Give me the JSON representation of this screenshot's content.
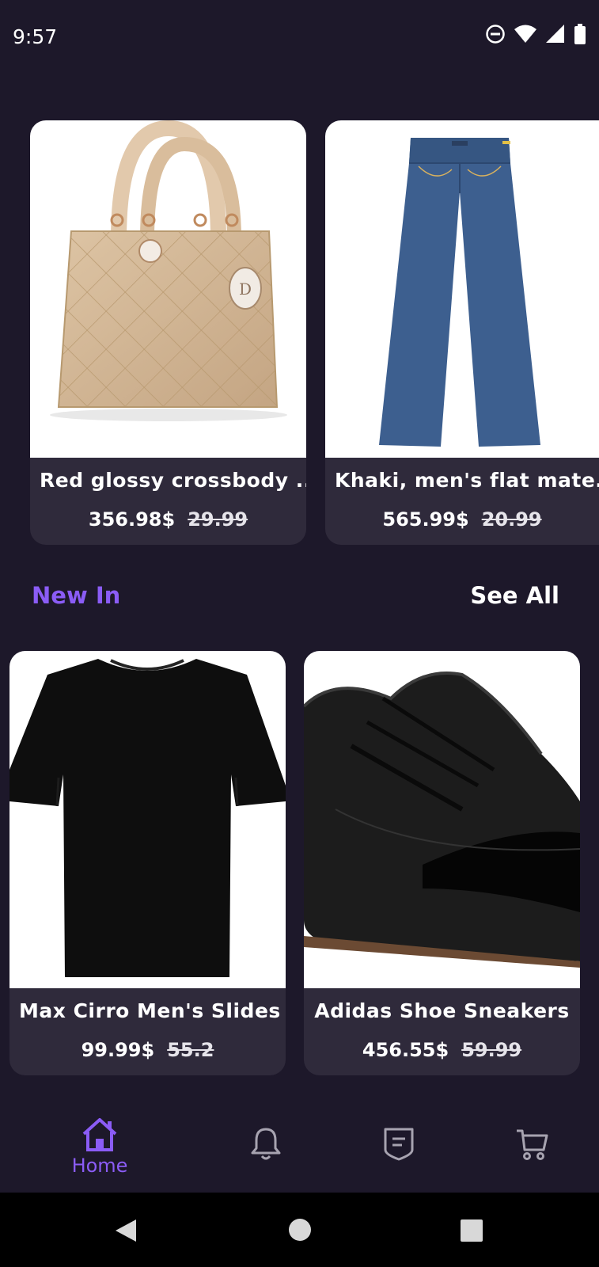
{
  "status_bar": {
    "time": "9:57",
    "icons": [
      "do-not-disturb-icon",
      "wifi-icon",
      "signal-icon",
      "battery-icon"
    ]
  },
  "featured": [
    {
      "name": "Red glossy crossbody ...",
      "price": "356.98$",
      "old_price": "29.99",
      "image": "beige-handbag"
    },
    {
      "name": "Khaki, men's flat mate...",
      "price": "565.99$",
      "old_price": "20.99",
      "image": "blue-jeans"
    }
  ],
  "new_in": {
    "title": "New In",
    "see_all": "See All",
    "items": [
      {
        "name": "Max Cirro Men's Slides",
        "price": "99.99$",
        "old_price": "55.2",
        "image": "black-tshirt"
      },
      {
        "name": "Adidas Shoe Sneakers",
        "price": "456.55$",
        "old_price": "59.99",
        "image": "black-leather-shoe"
      }
    ]
  },
  "bottom_nav": {
    "items": [
      {
        "label": "Home",
        "icon": "home-icon",
        "active": true
      },
      {
        "label": "",
        "icon": "bell-icon",
        "active": false
      },
      {
        "label": "",
        "icon": "receipt-icon",
        "active": false
      },
      {
        "label": "",
        "icon": "cart-icon",
        "active": false
      }
    ]
  },
  "colors": {
    "background": "#1d182a",
    "card": "#2f2a3b",
    "accent": "#8b5cf6",
    "text": "#ffffff"
  }
}
